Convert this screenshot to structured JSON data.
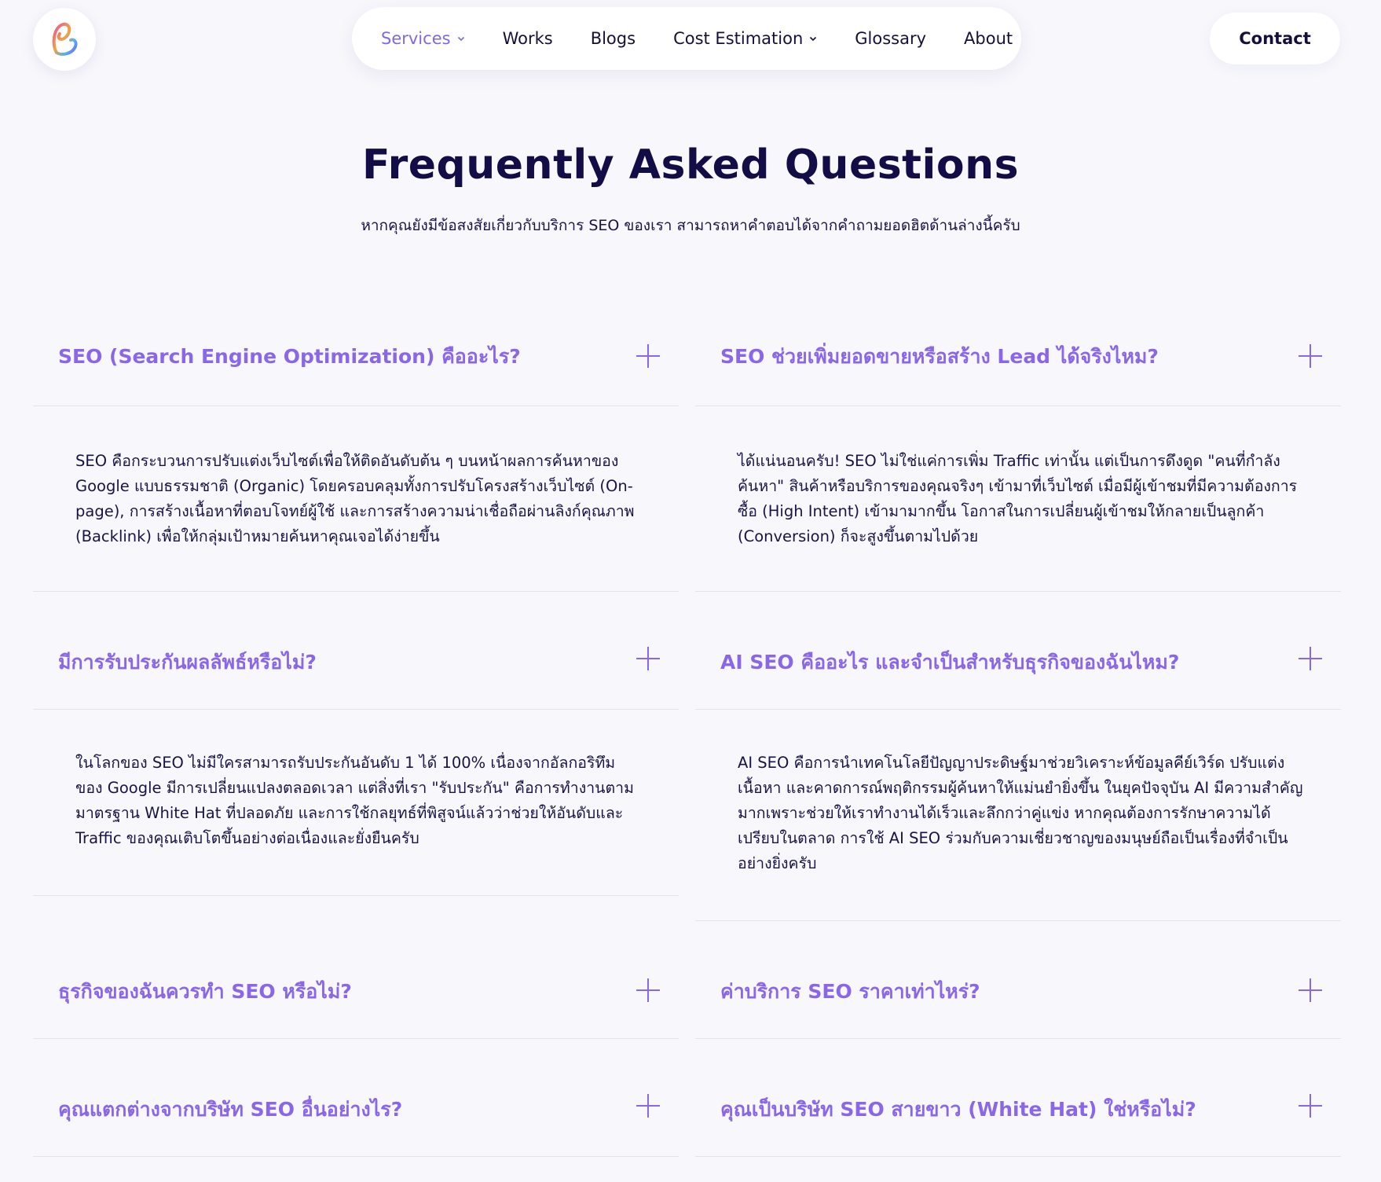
{
  "header": {
    "logo_icon": "brand-logo-icon",
    "nav": [
      {
        "label": "Services",
        "has_dropdown": true,
        "active": true
      },
      {
        "label": "Works",
        "has_dropdown": false,
        "active": false
      },
      {
        "label": "Blogs",
        "has_dropdown": false,
        "active": false
      },
      {
        "label": "Cost Estimation",
        "has_dropdown": true,
        "active": false
      },
      {
        "label": "Glossary",
        "has_dropdown": false,
        "active": false
      },
      {
        "label": "About",
        "has_dropdown": false,
        "active": false
      }
    ],
    "contact_label": "Contact"
  },
  "faq": {
    "title": "Frequently Asked Questions",
    "subtitle": "หากคุณยังมีข้อสงสัยเกี่ยวกับบริการ SEO ของเรา สามารถหาคำตอบได้จากคำถามยอดฮิตด้านล่างนี้ครับ",
    "left": [
      {
        "question": "SEO (Search Engine Optimization) คืออะไร?",
        "expanded": true,
        "answer": "SEO คือกระบวนการปรับแต่งเว็บไซต์เพื่อให้ติดอันดับต้น ๆ บนหน้าผลการค้นหาของ Google แบบธรรมชาติ (Organic) โดยครอบคลุมทั้งการปรับโครงสร้างเว็บไซต์ (On-page), การสร้างเนื้อหาที่ตอบโจทย์ผู้ใช้ และการสร้างความน่าเชื่อถือผ่านลิงก์คุณภาพ (Backlink) เพื่อให้กลุ่มเป้าหมายค้นหาคุณเจอได้ง่ายขึ้น"
      },
      {
        "question": "มีการรับประกันผลลัพธ์หรือไม่?",
        "expanded": true,
        "answer": "ในโลกของ SEO ไม่มีใครสามารถรับประกันอันดับ 1 ได้ 100% เนื่องจากอัลกอริทึมของ Google มีการเปลี่ยนแปลงตลอดเวลา แต่สิ่งที่เรา \"รับประกัน\" คือการทำงานตามมาตรฐาน White Hat ที่ปลอดภัย และการใช้กลยุทธ์ที่พิสูจน์แล้วว่าช่วยให้อันดับและ Traffic ของคุณเติบโตขึ้นอย่างต่อเนื่องและยั่งยืนครับ"
      },
      {
        "question": "ธุรกิจของฉันควรทำ SEO หรือไม่?",
        "expanded": false
      },
      {
        "question": "คุณแตกต่างจากบริษัท SEO อื่นอย่างไร?",
        "expanded": false
      }
    ],
    "right": [
      {
        "question": "SEO ช่วยเพิ่มยอดขายหรือสร้าง Lead ได้จริงไหม?",
        "expanded": true,
        "answer": "ได้แน่นอนครับ! SEO ไม่ใช่แค่การเพิ่ม Traffic เท่านั้น แต่เป็นการดึงดูด \"คนที่กำลังค้นหา\" สินค้าหรือบริการของคุณจริงๆ เข้ามาที่เว็บไซต์ เมื่อมีผู้เข้าชมที่มีความต้องการซื้อ (High Intent) เข้ามามากขึ้น โอกาสในการเปลี่ยนผู้เข้าชมให้กลายเป็นลูกค้า (Conversion) ก็จะสูงขึ้นตามไปด้วย"
      },
      {
        "question": "AI SEO คืออะไร และจำเป็นสำหรับธุรกิจของฉันไหม?",
        "expanded": true,
        "answer": "AI SEO คือการนำเทคโนโลยีปัญญาประดิษฐ์มาช่วยวิเคราะห์ข้อมูลคีย์เวิร์ด ปรับแต่งเนื้อหา และคาดการณ์พฤติกรรมผู้ค้นหาให้แม่นยำยิ่งขึ้น ในยุคปัจจุบัน AI มีความสำคัญมากเพราะช่วยให้เราทำงานได้เร็วและลึกกว่าคู่แข่ง หากคุณต้องการรักษาความได้เปรียบในตลาด การใช้ AI SEO ร่วมกับความเชี่ยวชาญของมนุษย์ถือเป็นเรื่องที่จำเป็นอย่างยิ่งครับ"
      },
      {
        "question": "ค่าบริการ SEO ราคาเท่าไหร่?",
        "expanded": false
      },
      {
        "question": "คุณเป็นบริษัท SEO สายขาว (White Hat) ใช่หรือไม่?",
        "expanded": false
      }
    ]
  },
  "colors": {
    "accent": "#8a67e8",
    "text": "#1a1446",
    "background": "#f7f7fc"
  }
}
